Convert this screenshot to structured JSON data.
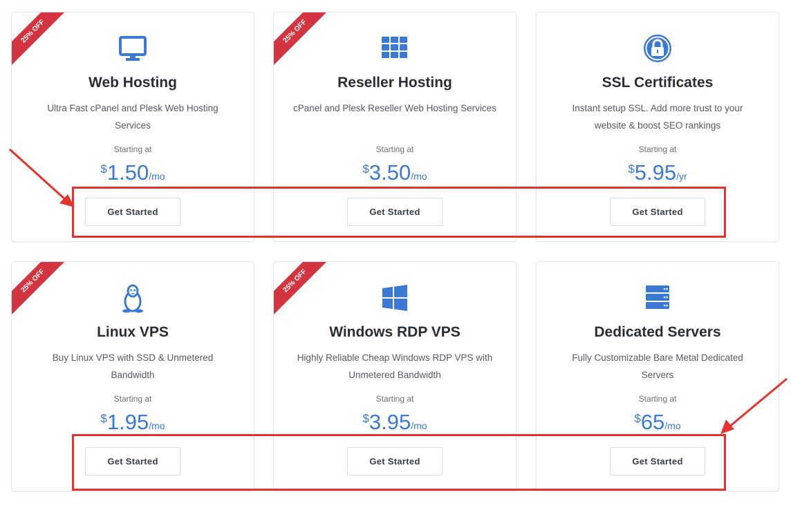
{
  "cards": [
    {
      "title": "Web Hosting",
      "desc": "Ultra Fast cPanel and Plesk Web Hosting Services",
      "starting": "Starting at",
      "currency": "$",
      "amount": "1.50",
      "period": "/mo",
      "badge": "25% OFF",
      "cta": "Get Started",
      "icon": "monitor-icon"
    },
    {
      "title": "Reseller Hosting",
      "desc": "cPanel and Plesk Reseller Web Hosting Services",
      "starting": "Starting at",
      "currency": "$",
      "amount": "3.50",
      "period": "/mo",
      "badge": "25% OFF",
      "cta": "Get Started",
      "icon": "grid-icon"
    },
    {
      "title": "SSL Certificates",
      "desc": "Instant setup SSL. Add more trust to your website & boost SEO rankings",
      "starting": "Starting at",
      "currency": "$",
      "amount": "5.95",
      "period": "/yr",
      "badge": "",
      "cta": "Get Started",
      "icon": "lock-icon"
    },
    {
      "title": "Linux VPS",
      "desc": "Buy Linux VPS with SSD & Unmetered Bandwidth",
      "starting": "Starting at",
      "currency": "$",
      "amount": "1.95",
      "period": "/mo",
      "badge": "25% OFF",
      "cta": "Get Started",
      "icon": "linux-penguin-icon"
    },
    {
      "title": "Windows RDP VPS",
      "desc": "Highly Reliable Cheap Windows RDP VPS with Unmetered Bandwidth",
      "starting": "Starting at",
      "currency": "$",
      "amount": "3.95",
      "period": "/mo",
      "badge": "25% OFF",
      "cta": "Get Started",
      "icon": "windows-icon"
    },
    {
      "title": "Dedicated Servers",
      "desc": "Fully Customizable Bare Metal Dedicated Servers",
      "starting": "Starting at",
      "currency": "$",
      "amount": "65",
      "period": "/mo",
      "badge": "",
      "cta": "Get Started",
      "icon": "server-icon"
    }
  ],
  "colors": {
    "accent": "#3a79d6",
    "ribbon": "#d3343f",
    "annotation": "#e5322d"
  }
}
